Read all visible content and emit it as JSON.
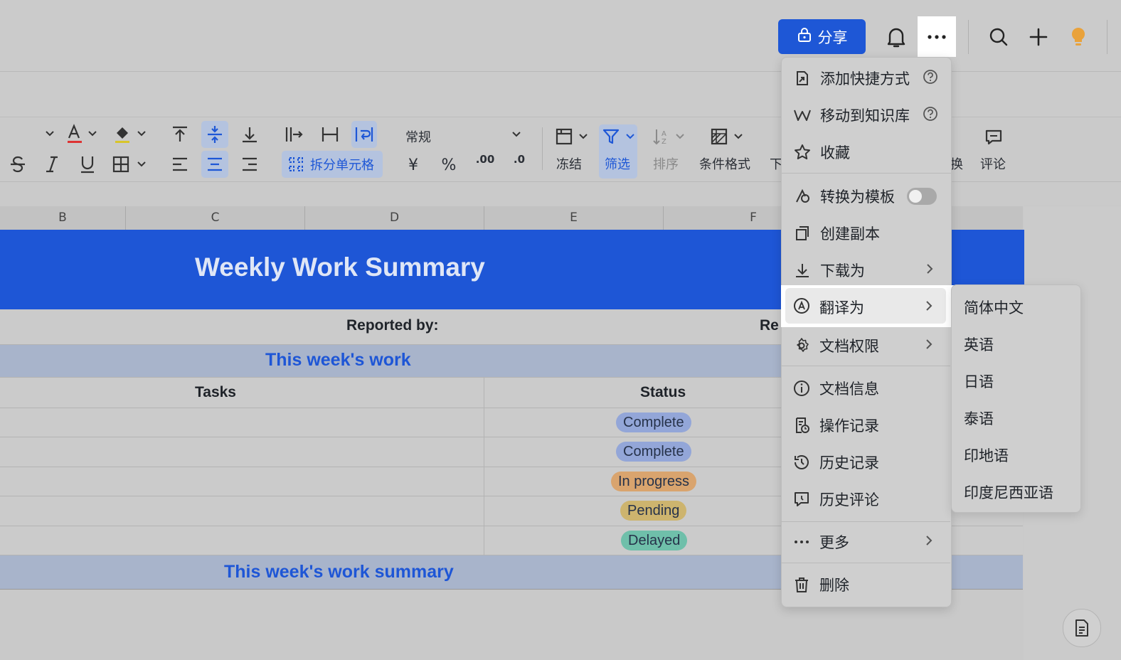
{
  "header": {
    "share_label": "分享"
  },
  "toolbar": {
    "split_cells_label": "拆分单元格",
    "number_format": "常规",
    "currency_symbol": "¥",
    "percent_symbol": "%",
    "decimal_increase": ".00",
    "decimal_decrease": ".0",
    "freeze_label": "冻结",
    "filter_label": "筛选",
    "sort_label": "排序",
    "conditional_format_label": "条件格式",
    "truncated_label_1": "下",
    "truncated_label_2": "换",
    "comment_label": "评论"
  },
  "columns": [
    "B",
    "C",
    "D",
    "E",
    "F"
  ],
  "sheet": {
    "title": "Weekly Work Summary",
    "reported_by_label": "Reported by:",
    "reported_truncated": "Re",
    "this_week_work": "This week's work",
    "tasks_header": "Tasks",
    "status_header": "Status",
    "statuses": [
      {
        "label": "Complete",
        "color": "#93a6d8"
      },
      {
        "label": "Complete",
        "color": "#93a6d8"
      },
      {
        "label": "In progress",
        "color": "#d9a46e"
      },
      {
        "label": "Pending",
        "color": "#cdb46e"
      },
      {
        "label": "Delayed",
        "color": "#6fbfaa"
      }
    ],
    "summary_label": "This week's work summary"
  },
  "menu": {
    "items": [
      {
        "label": "添加快捷方式",
        "icon": "shortcut-icon"
      },
      {
        "label": "移动到知识库",
        "icon": "wiki-icon"
      },
      {
        "label": "收藏",
        "icon": "star-icon"
      },
      {
        "label": "转换为模板",
        "icon": "template-icon"
      },
      {
        "label": "创建副本",
        "icon": "copy-icon"
      },
      {
        "label": "下载为",
        "icon": "download-icon"
      },
      {
        "label": "翻译为",
        "icon": "translate-icon"
      },
      {
        "label": "文档权限",
        "icon": "gear-icon"
      },
      {
        "label": "文档信息",
        "icon": "info-icon"
      },
      {
        "label": "操作记录",
        "icon": "log-icon"
      },
      {
        "label": "历史记录",
        "icon": "history-icon"
      },
      {
        "label": "历史评论",
        "icon": "comment-history-icon"
      },
      {
        "label": "更多",
        "icon": "ellipsis-icon"
      },
      {
        "label": "删除",
        "icon": "trash-icon"
      }
    ]
  },
  "translate_submenu": {
    "items": [
      "简体中文",
      "英语",
      "日语",
      "泰语",
      "印地语",
      "印度尼西亚语"
    ]
  },
  "colors": {
    "accent": "#1e57d6",
    "title_band": "#1e56d6",
    "section_band": "#a8b4cb"
  }
}
